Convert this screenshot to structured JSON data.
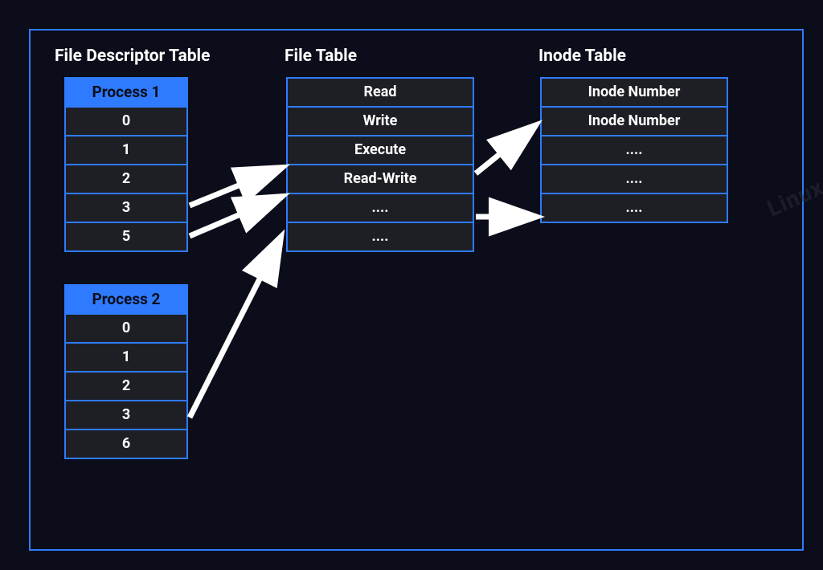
{
  "titles": {
    "fd": "File Descriptor Table",
    "ft": "File Table",
    "it": "Inode Table"
  },
  "process1": {
    "header": "Process 1",
    "rows": [
      "0",
      "1",
      "2",
      "3",
      "5"
    ]
  },
  "process2": {
    "header": "Process 2",
    "rows": [
      "0",
      "1",
      "2",
      "3",
      "6"
    ]
  },
  "fileTable": {
    "rows": [
      "Read",
      "Write",
      "Execute",
      "Read-Write",
      "....",
      "...."
    ]
  },
  "inodeTable": {
    "rows": [
      "Inode Number",
      "Inode Number",
      "....",
      "....",
      "...."
    ]
  },
  "watermark": "Linux"
}
